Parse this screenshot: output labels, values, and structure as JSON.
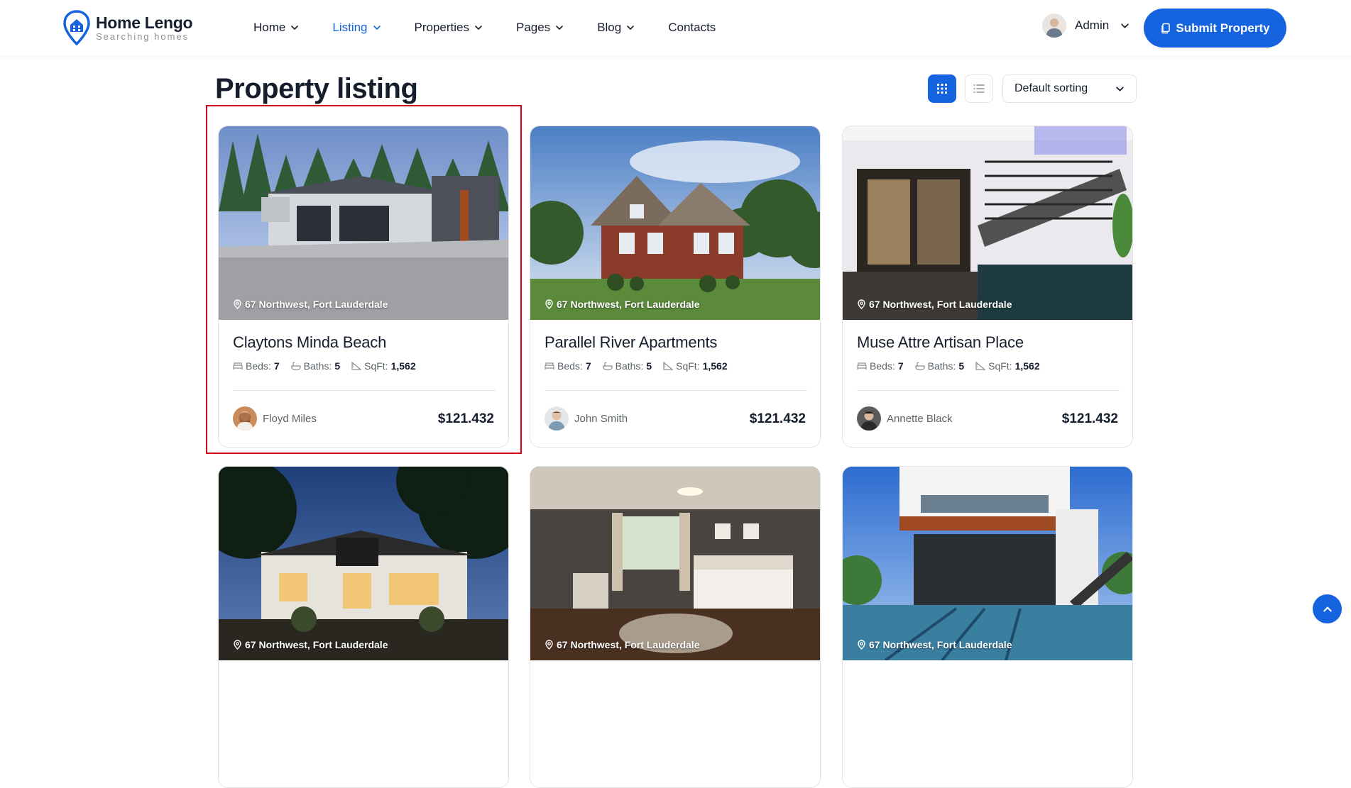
{
  "brand": {
    "name": "Home Lengo",
    "tagline": "Searching homes",
    "color": "#1563df"
  },
  "nav": [
    {
      "label": "Home",
      "active": false,
      "dropdown": true
    },
    {
      "label": "Listing",
      "active": true,
      "dropdown": true
    },
    {
      "label": "Properties",
      "active": false,
      "dropdown": true
    },
    {
      "label": "Pages",
      "active": false,
      "dropdown": true
    },
    {
      "label": "Blog",
      "active": false,
      "dropdown": true
    },
    {
      "label": "Contacts",
      "active": false,
      "dropdown": false
    }
  ],
  "user": {
    "name": "Admin"
  },
  "submit_label": "Submit Property",
  "page_title": "Property listing",
  "sort": {
    "selected": "Default sorting"
  },
  "labels": {
    "beds": "Beds:",
    "baths": "Baths:",
    "sqft": "SqFt:"
  },
  "cards": [
    {
      "location": "67 Northwest, Fort Lauderdale",
      "title": "Claytons Minda Beach",
      "beds": "7",
      "baths": "5",
      "sqft": "1,562",
      "agent": "Floyd Miles",
      "price": "$121.432"
    },
    {
      "location": "67 Northwest, Fort Lauderdale",
      "title": "Parallel River Apartments",
      "beds": "7",
      "baths": "5",
      "sqft": "1,562",
      "agent": "John Smith",
      "price": "$121.432"
    },
    {
      "location": "67 Northwest, Fort Lauderdale",
      "title": "Muse Attre Artisan Place",
      "beds": "7",
      "baths": "5",
      "sqft": "1,562",
      "agent": "Annette Black",
      "price": "$121.432"
    },
    {
      "location": "67 Northwest, Fort Lauderdale"
    },
    {
      "location": "67 Northwest, Fort Lauderdale"
    },
    {
      "location": "67 Northwest, Fort Lauderdale"
    }
  ]
}
